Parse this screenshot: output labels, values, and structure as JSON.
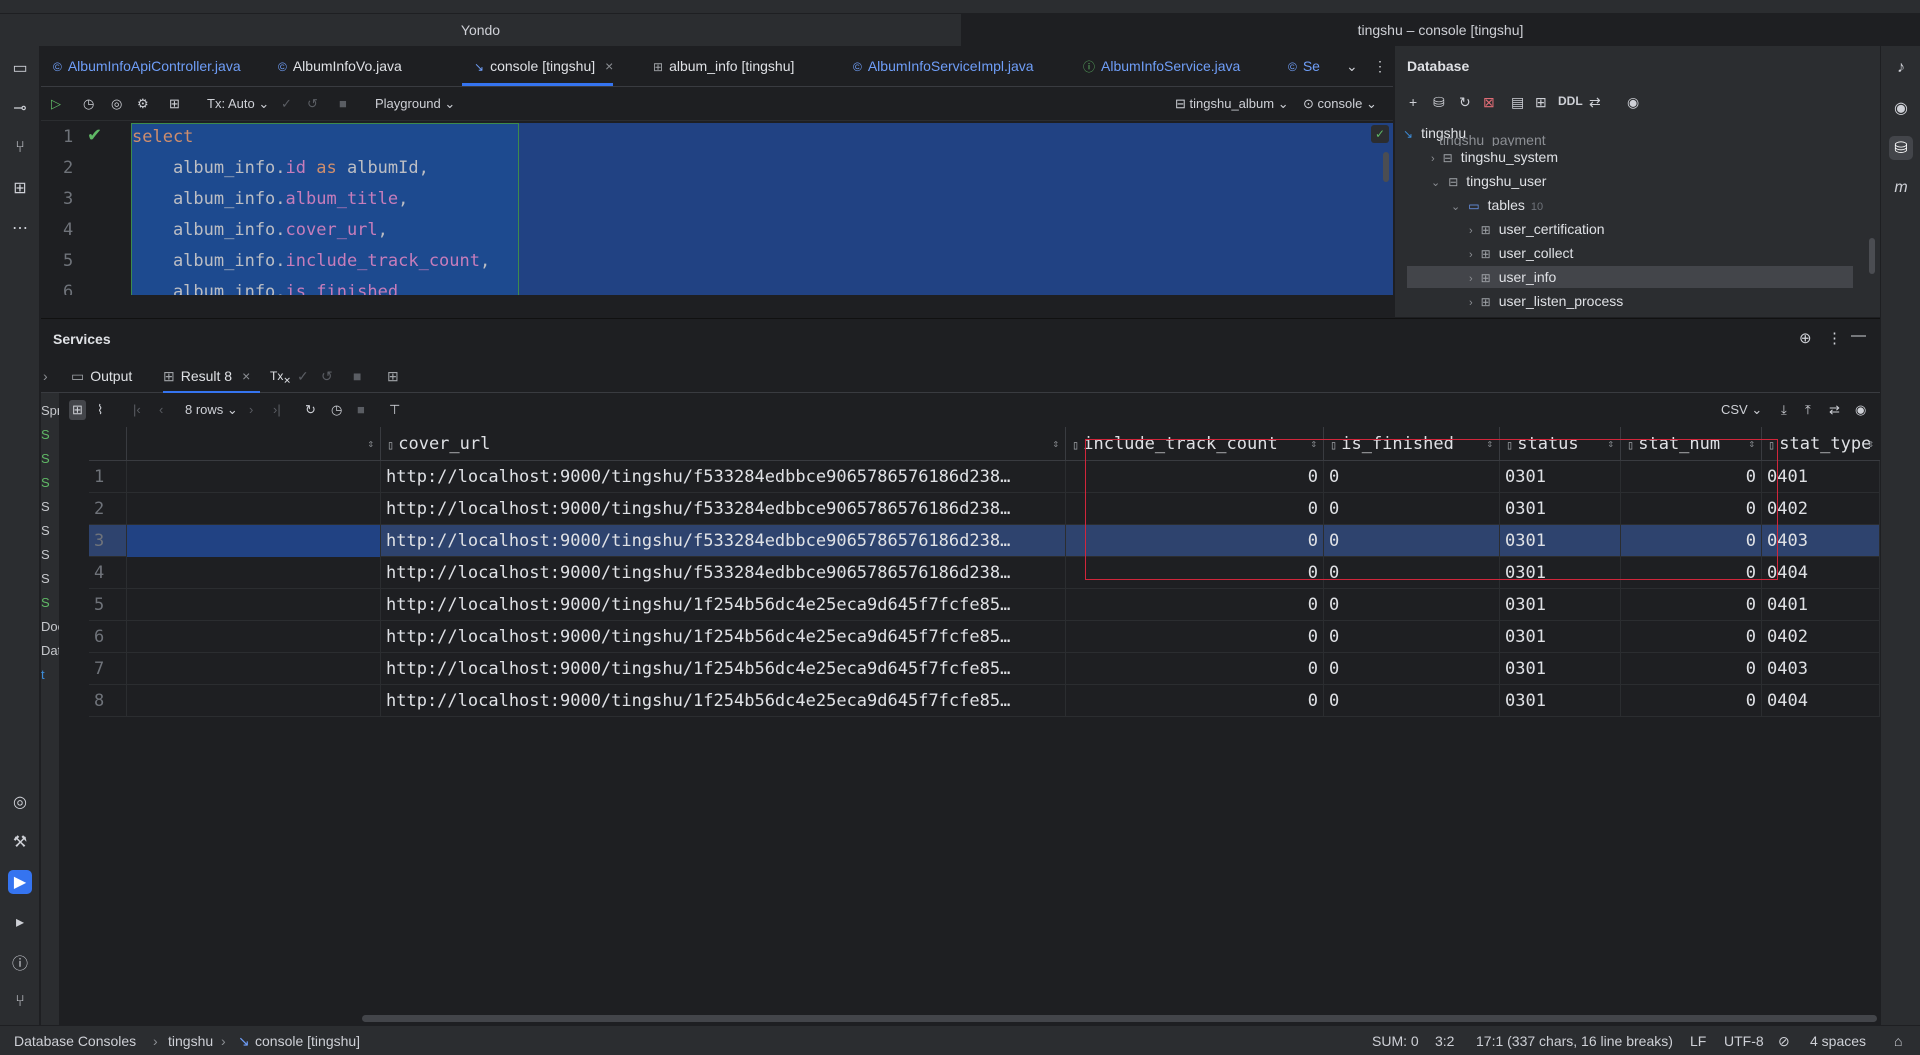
{
  "window": {
    "title_left": "Yondo",
    "title_right": "tingshu – console [tingshu]"
  },
  "editor_tabs": [
    {
      "label": "AlbumInfoApiController.java",
      "icon": "class-icon"
    },
    {
      "label": "AlbumInfoVo.java",
      "icon": "class-icon"
    },
    {
      "label": "console [tingshu]",
      "icon": "console-icon",
      "active": true
    },
    {
      "label": "album_info [tingshu]",
      "icon": "table-icon"
    },
    {
      "label": "AlbumInfoServiceImpl.java",
      "icon": "class-icon"
    },
    {
      "label": "AlbumInfoService.java",
      "icon": "interface-icon"
    },
    {
      "label": "Se",
      "icon": "class-icon"
    }
  ],
  "editor_toolbar": {
    "tx_mode": "Tx: Auto",
    "playground": "Playground",
    "schema": "tingshu_album",
    "session": "console"
  },
  "editor_lines": {
    "n1": "1",
    "n2": "2",
    "n3": "3",
    "n4": "4",
    "n5": "5",
    "n6": "6",
    "l1_kw": "select",
    "l2_a": "    album_info.",
    "l2_b": "id",
    "l2_c": " as ",
    "l2_d": "albumId,",
    "l3_a": "    album_info.",
    "l3_b": "album_title",
    "l3_c": ",",
    "l4_a": "    album_info.",
    "l4_b": "cover_url",
    "l4_c": ",",
    "l5_a": "    album_info.",
    "l5_b": "include_track_count",
    "l5_c": ",",
    "l6_a": "    album_info.",
    "l6_b": "is_finished"
  },
  "database_panel": {
    "title": "Database",
    "ddl_label": "DDL",
    "root": "tingshu",
    "partial_item": "tingshu_payment",
    "items": [
      {
        "label": "tingshu_system"
      },
      {
        "label": "tingshu_user"
      },
      {
        "label": "tables",
        "count": "10"
      },
      {
        "label": "user_certification"
      },
      {
        "label": "user_collect"
      },
      {
        "label": "user_info"
      },
      {
        "label": "user_listen_process"
      }
    ]
  },
  "services": {
    "title": "Services",
    "tab_output": "Output",
    "tab_result": "Result 8",
    "tx_label": "Tx",
    "rows_label": "8 rows",
    "export_format": "CSV",
    "left_tree": [
      "Spri",
      "S",
      "S",
      "S",
      "S",
      "S",
      "S",
      "S",
      "S",
      "Doc",
      "Data",
      "t"
    ]
  },
  "grid": {
    "columns": [
      "",
      "cover_url",
      "include_track_count",
      "is_finished",
      "status",
      "stat_num",
      "stat_type"
    ],
    "rows": [
      [
        "1",
        "http://localhost:9000/tingshu/f533284edbbce9065786576186d238…",
        "0",
        "0",
        "0301",
        "0",
        "0401"
      ],
      [
        "2",
        "http://localhost:9000/tingshu/f533284edbbce9065786576186d238…",
        "0",
        "0",
        "0301",
        "0",
        "0402"
      ],
      [
        "3",
        "http://localhost:9000/tingshu/f533284edbbce9065786576186d238…",
        "0",
        "0",
        "0301",
        "0",
        "0403"
      ],
      [
        "4",
        "http://localhost:9000/tingshu/f533284edbbce9065786576186d238…",
        "0",
        "0",
        "0301",
        "0",
        "0404"
      ],
      [
        "5",
        "http://localhost:9000/tingshu/1f254b56dc4e25eca9d645f7fcfe85…",
        "0",
        "0",
        "0301",
        "0",
        "0401"
      ],
      [
        "6",
        "http://localhost:9000/tingshu/1f254b56dc4e25eca9d645f7fcfe85…",
        "0",
        "0",
        "0301",
        "0",
        "0402"
      ],
      [
        "7",
        "http://localhost:9000/tingshu/1f254b56dc4e25eca9d645f7fcfe85…",
        "0",
        "0",
        "0301",
        "0",
        "0403"
      ],
      [
        "8",
        "http://localhost:9000/tingshu/1f254b56dc4e25eca9d645f7fcfe85…",
        "0",
        "0",
        "0301",
        "0",
        "0404"
      ]
    ],
    "selected_row": 3,
    "highlight_color": "#d1263b"
  },
  "statusbar": {
    "breadcrumb_1": "Database Consoles",
    "breadcrumb_2": "tingshu",
    "breadcrumb_3": "console [tingshu]",
    "sum": "SUM: 0",
    "caret": "3:2",
    "selection": "17:1 (337 chars, 16 line breaks)",
    "line_sep": "LF",
    "encoding": "UTF-8",
    "indent": "4 spaces"
  },
  "colors": {
    "accent": "#3574f0",
    "selection": "#214283",
    "keyword": "#cf8e6d",
    "field": "#c77dbb"
  }
}
